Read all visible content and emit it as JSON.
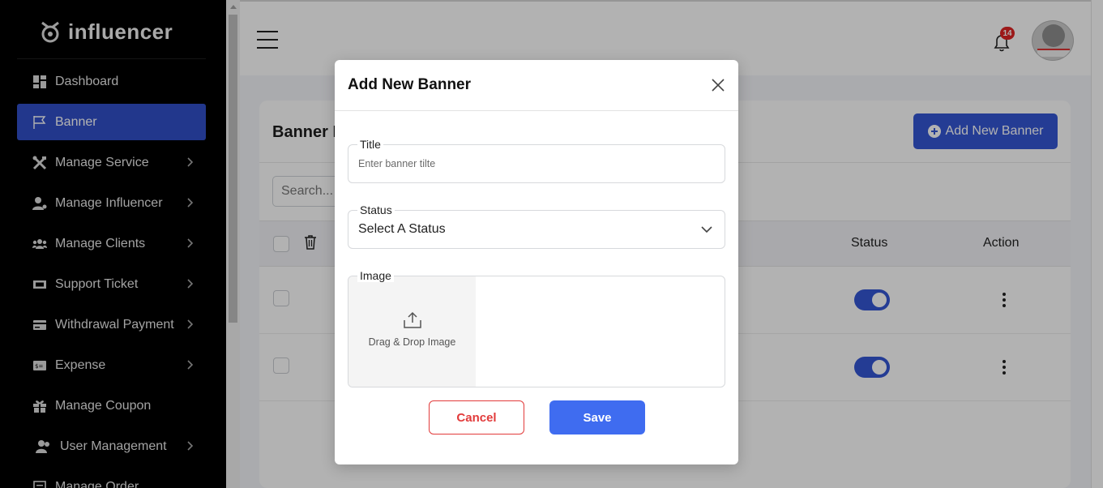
{
  "app": {
    "logo_text": "influencer"
  },
  "sidebar": {
    "items": [
      {
        "label": "Dashboard",
        "icon": "dashboard-icon",
        "active": false,
        "has_children": false
      },
      {
        "label": "Banner",
        "icon": "flag-icon",
        "active": true,
        "has_children": false
      },
      {
        "label": "Manage Service",
        "icon": "tools-icon",
        "active": false,
        "has_children": true
      },
      {
        "label": "Manage Influencer",
        "icon": "user-gear-icon",
        "active": false,
        "has_children": true
      },
      {
        "label": "Manage Clients",
        "icon": "users-icon",
        "active": false,
        "has_children": true
      },
      {
        "label": "Support Ticket",
        "icon": "ticket-icon",
        "active": false,
        "has_children": true
      },
      {
        "label": "Withdrawal Payment",
        "icon": "credit-card-icon",
        "active": false,
        "has_children": true
      },
      {
        "label": "Expense",
        "icon": "money-bill-icon",
        "active": false,
        "has_children": true
      },
      {
        "label": "Manage Coupon",
        "icon": "gift-icon",
        "active": false,
        "has_children": false
      },
      {
        "label": "User Management",
        "icon": "user-group-icon",
        "active": false,
        "has_children": true
      },
      {
        "label": "Manage Order",
        "icon": "clipboard-icon",
        "active": false,
        "has_children": false
      }
    ]
  },
  "header": {
    "notification_count": "14"
  },
  "page": {
    "title": "Banner L",
    "add_button_label": "Add New Banner",
    "search_placeholder": "Search...",
    "columns": {
      "status": "Status",
      "action": "Action"
    },
    "rows": [
      {
        "status_on": true
      },
      {
        "status_on": true
      }
    ]
  },
  "modal": {
    "title": "Add New Banner",
    "title_field": {
      "label": "Title",
      "placeholder": "Enter banner tilte"
    },
    "status_field": {
      "label": "Status",
      "value": "Select A Status"
    },
    "image_field": {
      "label": "Image",
      "drop_text": "Drag & Drop Image"
    },
    "cancel_label": "Cancel",
    "save_label": "Save"
  },
  "colors": {
    "sidebar_bg": "#000000",
    "active_item": "#3150c9",
    "primary": "#3457d5",
    "save_button": "#3f6cf0",
    "cancel_border": "#e23b3b",
    "badge": "#e02424"
  }
}
